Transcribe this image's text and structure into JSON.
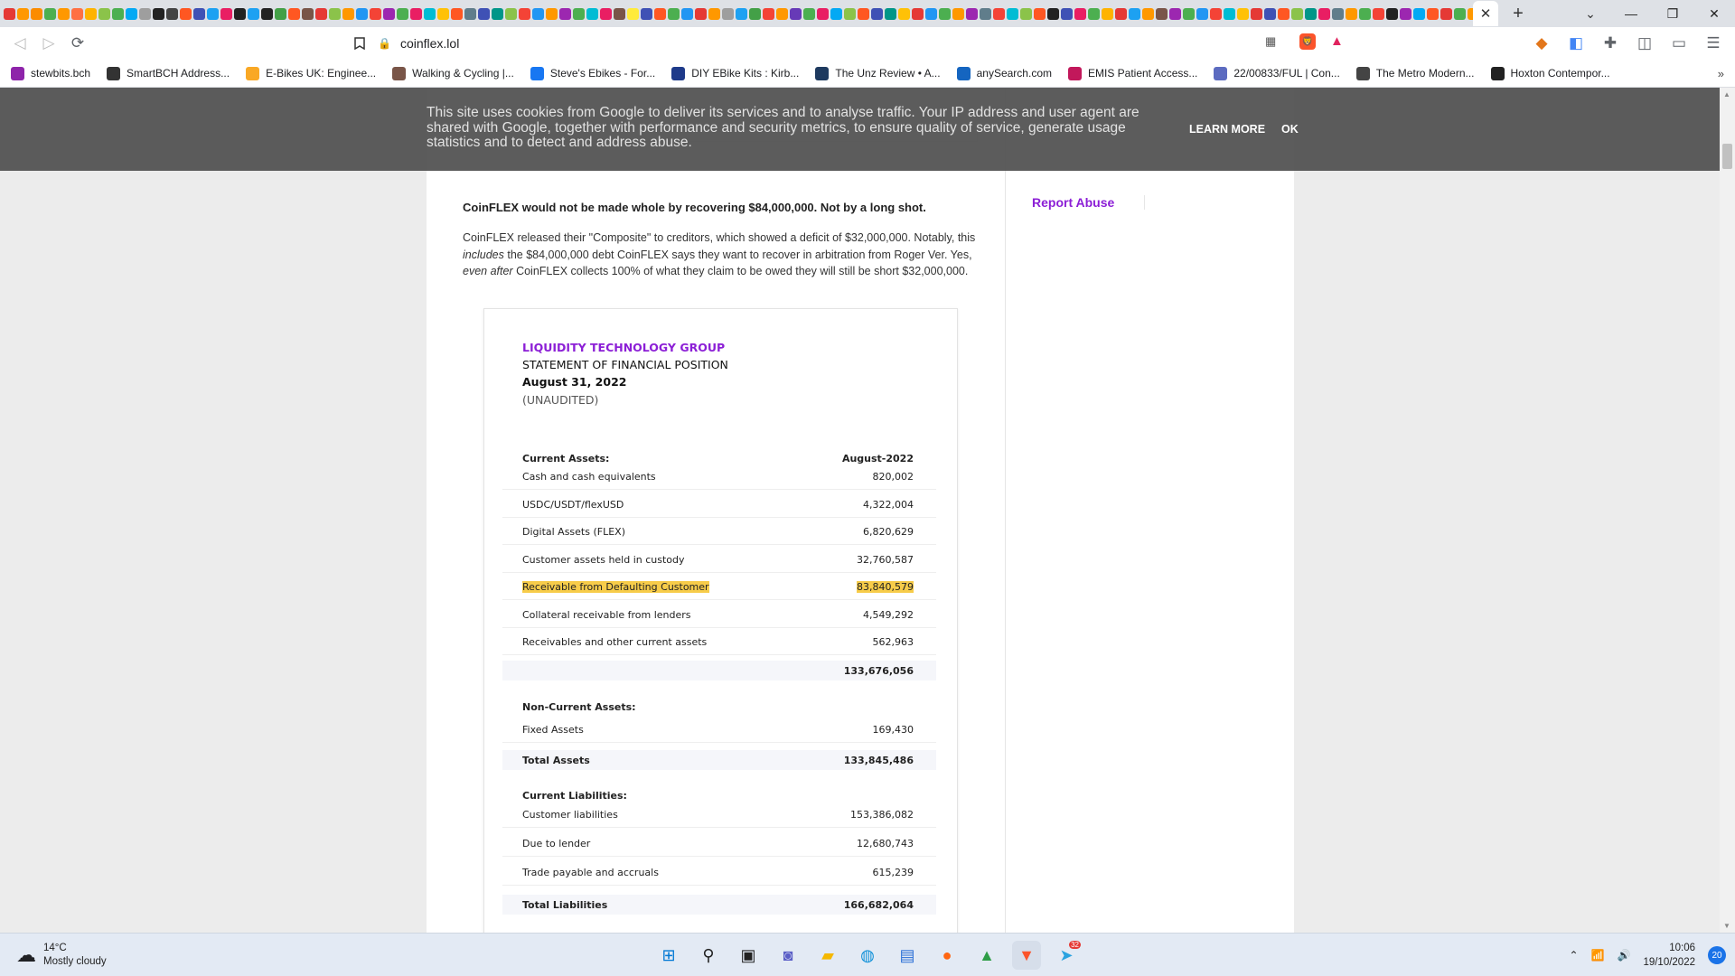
{
  "browser": {
    "active_tab_close": "✕",
    "new_tab": "+",
    "window_controls": [
      "⌄",
      "—",
      "❐",
      "✕"
    ],
    "tab_favicon_colors": [
      "#e53935",
      "#ff9800",
      "#fb8c00",
      "#4caf50",
      "#ff9800",
      "#ff7043",
      "#ffb300",
      "#8bc34a",
      "#4caf50",
      "#03a9f4",
      "#9e9e9e",
      "#222222",
      "#444444",
      "#ff5722",
      "#3f51b5",
      "#1da1f2",
      "#e91e63",
      "#222222",
      "#1da1f2",
      "#222222",
      "#43a047",
      "#ff5722",
      "#795548",
      "#e53935",
      "#8bc34a",
      "#ff9800",
      "#2196f3",
      "#f44336",
      "#9c27b0",
      "#4caf50",
      "#e91e63",
      "#00bcd4",
      "#ffc107",
      "#ff5722",
      "#607d8b",
      "#3f51b5",
      "#009688",
      "#8bc34a",
      "#f44336",
      "#2196f3",
      "#ff9800",
      "#9c27b0",
      "#4caf50",
      "#00bcd4",
      "#e91e63",
      "#795548",
      "#ffeb3b",
      "#3f51b5",
      "#ff5722",
      "#4caf50",
      "#2196f3",
      "#e53935",
      "#ff9800",
      "#9e9e9e",
      "#1da1f2",
      "#43a047",
      "#f44336",
      "#ff9800",
      "#673ab7",
      "#4caf50",
      "#e91e63",
      "#03a9f4",
      "#8bc34a",
      "#ff5722",
      "#3f51b5",
      "#009688",
      "#ffc107",
      "#e53935",
      "#2196f3",
      "#4caf50",
      "#ff9800",
      "#9c27b0",
      "#607d8b",
      "#f44336",
      "#00bcd4",
      "#8bc34a",
      "#ff5722",
      "#222222",
      "#3f51b5",
      "#e91e63",
      "#4caf50",
      "#ffb300",
      "#e53935",
      "#1da1f2",
      "#ff9800",
      "#795548",
      "#9c27b0",
      "#4caf50",
      "#2196f3",
      "#f44336",
      "#00bcd4",
      "#ffc107",
      "#e53935",
      "#3f51b5",
      "#ff5722",
      "#8bc34a",
      "#009688",
      "#e91e63",
      "#607d8b",
      "#ff9800",
      "#4caf50",
      "#f44336",
      "#222222",
      "#9c27b0",
      "#03a9f4",
      "#ff5722",
      "#e53935",
      "#4caf50",
      "#ff9800",
      "#2196f3",
      "#e53935",
      "#8bc34a"
    ],
    "url": "coinflex.lol",
    "bookmarks": [
      {
        "label": "stewbits.bch",
        "color": "#8e24aa"
      },
      {
        "label": "SmartBCH Address...",
        "color": "#333333"
      },
      {
        "label": "E-Bikes UK: Enginee...",
        "color": "#f9a825"
      },
      {
        "label": "Walking & Cycling |...",
        "color": "#795548"
      },
      {
        "label": "Steve's Ebikes - For...",
        "color": "#1877f2"
      },
      {
        "label": "DIY EBike Kits : Kirb...",
        "color": "#1e3a8a"
      },
      {
        "label": "The Unz Review • A...",
        "color": "#1e3a5f"
      },
      {
        "label": "anySearch.com",
        "color": "#1565c0"
      },
      {
        "label": "EMIS Patient Access...",
        "color": "#c2185b"
      },
      {
        "label": "22/00833/FUL | Con...",
        "color": "#5c6bc0"
      },
      {
        "label": "The Metro Modern...",
        "color": "#444444"
      },
      {
        "label": "Hoxton Contempor...",
        "color": "#222222"
      }
    ],
    "bookmarks_more": "»"
  },
  "cookie_banner": {
    "text": "This site uses cookies from Google to deliver its services and to analyse traffic. Your IP address and user agent are shared with Google, together with performance and security metrics, to ensure quality of service, generate usage statistics and to detect and address abuse.",
    "learn_more": "LEARN MORE",
    "ok": "OK"
  },
  "sidebar": {
    "report_abuse": "Report Abuse"
  },
  "article": {
    "lead": "CoinFLEX would not be made whole by recovering $84,000,000. Not by a long shot.",
    "para_1": "CoinFLEX released their \"Composite\" to creditors, which showed a deficit of $32,000,000. Notably, this ",
    "para_em_1": "includes",
    "para_2": " the $84,000,000 debt CoinFLEX says they want to recover in arbitration from Roger Ver. Yes, ",
    "para_em_2": "even after",
    "para_3": " CoinFLEX collects 100% of what they claim to be owed they will still be short $32,000,000."
  },
  "statement": {
    "company": "LIQUIDITY TECHNOLOGY GROUP",
    "title": "STATEMENT OF FINANCIAL POSITION",
    "date": "August 31, 2022",
    "unaudited": "(UNAUDITED)",
    "current_assets_header": "Current Assets:",
    "period_header": "August-2022",
    "rows": [
      {
        "label": "Cash and cash equivalents",
        "value": "820,002"
      },
      {
        "label": "USDC/USDT/flexUSD",
        "value": "4,322,004"
      },
      {
        "label": "Digital Assets (FLEX)",
        "value": "6,820,629"
      },
      {
        "label": "Customer assets held in custody",
        "value": "32,760,587"
      },
      {
        "label": "Receivable from Defaulting Customer",
        "value": "83,840,579"
      },
      {
        "label": "Collateral receivable from lenders",
        "value": "4,549,292"
      },
      {
        "label": "Receivables and other current assets",
        "value": "562,963"
      }
    ],
    "current_assets_total": "133,676,056",
    "non_current_header": "Non-Current Assets:",
    "fixed_assets_label": "Fixed Assets",
    "fixed_assets_value": "169,430",
    "total_assets_label": "Total Assets",
    "total_assets_value": "133,845,486",
    "current_liabilities_header": "Current Liabilities:",
    "liab_rows": [
      {
        "label": "Customer liabilities",
        "value": "153,386,082"
      },
      {
        "label": "Due to lender",
        "value": "12,680,743"
      },
      {
        "label": "Trade payable and accruals",
        "value": "615,239"
      }
    ],
    "total_liabilities_label": "Total Liabilities",
    "total_liabilities_value": "166,682,064",
    "highlight_color": "#f7cc4a",
    "brand_color": "#8c1fd6"
  },
  "taskbar": {
    "temperature": "14°C",
    "weather": "Mostly cloudy",
    "time": "10:06",
    "date": "19/10/2022",
    "notifications": "20",
    "telegram_badge": "32"
  }
}
